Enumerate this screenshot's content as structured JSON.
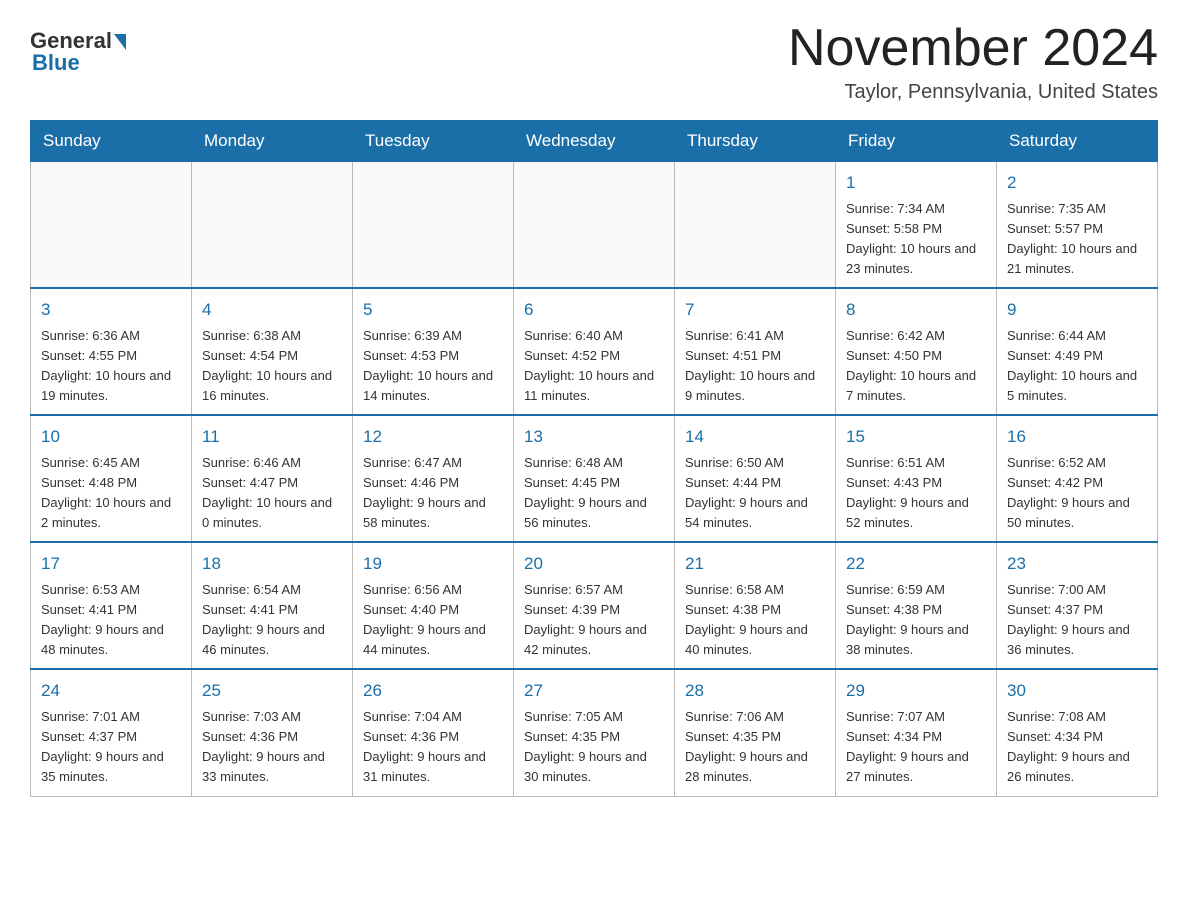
{
  "header": {
    "logo_general": "General",
    "logo_blue": "Blue",
    "title": "November 2024",
    "subtitle": "Taylor, Pennsylvania, United States"
  },
  "days_of_week": [
    "Sunday",
    "Monday",
    "Tuesday",
    "Wednesday",
    "Thursday",
    "Friday",
    "Saturday"
  ],
  "weeks": [
    {
      "cells": [
        {
          "day": "",
          "info": ""
        },
        {
          "day": "",
          "info": ""
        },
        {
          "day": "",
          "info": ""
        },
        {
          "day": "",
          "info": ""
        },
        {
          "day": "",
          "info": ""
        },
        {
          "day": "1",
          "info": "Sunrise: 7:34 AM\nSunset: 5:58 PM\nDaylight: 10 hours and 23 minutes."
        },
        {
          "day": "2",
          "info": "Sunrise: 7:35 AM\nSunset: 5:57 PM\nDaylight: 10 hours and 21 minutes."
        }
      ]
    },
    {
      "cells": [
        {
          "day": "3",
          "info": "Sunrise: 6:36 AM\nSunset: 4:55 PM\nDaylight: 10 hours and 19 minutes."
        },
        {
          "day": "4",
          "info": "Sunrise: 6:38 AM\nSunset: 4:54 PM\nDaylight: 10 hours and 16 minutes."
        },
        {
          "day": "5",
          "info": "Sunrise: 6:39 AM\nSunset: 4:53 PM\nDaylight: 10 hours and 14 minutes."
        },
        {
          "day": "6",
          "info": "Sunrise: 6:40 AM\nSunset: 4:52 PM\nDaylight: 10 hours and 11 minutes."
        },
        {
          "day": "7",
          "info": "Sunrise: 6:41 AM\nSunset: 4:51 PM\nDaylight: 10 hours and 9 minutes."
        },
        {
          "day": "8",
          "info": "Sunrise: 6:42 AM\nSunset: 4:50 PM\nDaylight: 10 hours and 7 minutes."
        },
        {
          "day": "9",
          "info": "Sunrise: 6:44 AM\nSunset: 4:49 PM\nDaylight: 10 hours and 5 minutes."
        }
      ]
    },
    {
      "cells": [
        {
          "day": "10",
          "info": "Sunrise: 6:45 AM\nSunset: 4:48 PM\nDaylight: 10 hours and 2 minutes."
        },
        {
          "day": "11",
          "info": "Sunrise: 6:46 AM\nSunset: 4:47 PM\nDaylight: 10 hours and 0 minutes."
        },
        {
          "day": "12",
          "info": "Sunrise: 6:47 AM\nSunset: 4:46 PM\nDaylight: 9 hours and 58 minutes."
        },
        {
          "day": "13",
          "info": "Sunrise: 6:48 AM\nSunset: 4:45 PM\nDaylight: 9 hours and 56 minutes."
        },
        {
          "day": "14",
          "info": "Sunrise: 6:50 AM\nSunset: 4:44 PM\nDaylight: 9 hours and 54 minutes."
        },
        {
          "day": "15",
          "info": "Sunrise: 6:51 AM\nSunset: 4:43 PM\nDaylight: 9 hours and 52 minutes."
        },
        {
          "day": "16",
          "info": "Sunrise: 6:52 AM\nSunset: 4:42 PM\nDaylight: 9 hours and 50 minutes."
        }
      ]
    },
    {
      "cells": [
        {
          "day": "17",
          "info": "Sunrise: 6:53 AM\nSunset: 4:41 PM\nDaylight: 9 hours and 48 minutes."
        },
        {
          "day": "18",
          "info": "Sunrise: 6:54 AM\nSunset: 4:41 PM\nDaylight: 9 hours and 46 minutes."
        },
        {
          "day": "19",
          "info": "Sunrise: 6:56 AM\nSunset: 4:40 PM\nDaylight: 9 hours and 44 minutes."
        },
        {
          "day": "20",
          "info": "Sunrise: 6:57 AM\nSunset: 4:39 PM\nDaylight: 9 hours and 42 minutes."
        },
        {
          "day": "21",
          "info": "Sunrise: 6:58 AM\nSunset: 4:38 PM\nDaylight: 9 hours and 40 minutes."
        },
        {
          "day": "22",
          "info": "Sunrise: 6:59 AM\nSunset: 4:38 PM\nDaylight: 9 hours and 38 minutes."
        },
        {
          "day": "23",
          "info": "Sunrise: 7:00 AM\nSunset: 4:37 PM\nDaylight: 9 hours and 36 minutes."
        }
      ]
    },
    {
      "cells": [
        {
          "day": "24",
          "info": "Sunrise: 7:01 AM\nSunset: 4:37 PM\nDaylight: 9 hours and 35 minutes."
        },
        {
          "day": "25",
          "info": "Sunrise: 7:03 AM\nSunset: 4:36 PM\nDaylight: 9 hours and 33 minutes."
        },
        {
          "day": "26",
          "info": "Sunrise: 7:04 AM\nSunset: 4:36 PM\nDaylight: 9 hours and 31 minutes."
        },
        {
          "day": "27",
          "info": "Sunrise: 7:05 AM\nSunset: 4:35 PM\nDaylight: 9 hours and 30 minutes."
        },
        {
          "day": "28",
          "info": "Sunrise: 7:06 AM\nSunset: 4:35 PM\nDaylight: 9 hours and 28 minutes."
        },
        {
          "day": "29",
          "info": "Sunrise: 7:07 AM\nSunset: 4:34 PM\nDaylight: 9 hours and 27 minutes."
        },
        {
          "day": "30",
          "info": "Sunrise: 7:08 AM\nSunset: 4:34 PM\nDaylight: 9 hours and 26 minutes."
        }
      ]
    }
  ]
}
